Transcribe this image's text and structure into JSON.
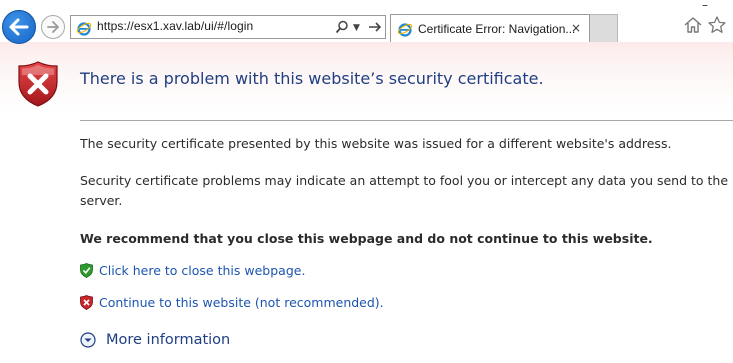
{
  "browser": {
    "address_url": "https://esx1.xav.lab/ui/#/login",
    "tab_title": "Certificate Error: Navigation...",
    "tab_close": "×",
    "minimize": "–",
    "icons": [
      "back-arrow-icon",
      "forward-arrow-icon",
      "ie-logo-icon",
      "search-icon",
      "dropdown-arrow-icon",
      "go-arrow-icon",
      "home-icon",
      "favorites-star-icon"
    ]
  },
  "content": {
    "headline": "There is a problem with this website’s security certificate.",
    "paragraph1": "The security certificate presented by this website was issued for a different website's address.",
    "paragraph2": "Security certificate problems may indicate an attempt to fool you or intercept any data you send to the server.",
    "recommendation": "We recommend that you close this webpage and do not continue to this website.",
    "close_link": "Click here to close this webpage.",
    "continue_link": "Continue to this website (not recommended).",
    "more_info": "More information",
    "icons": [
      "error-shield-icon",
      "green-shield-icon",
      "red-shield-icon",
      "expand-chevron-icon"
    ]
  },
  "colors": {
    "headline": "#1f3f82",
    "link": "#1c55b0",
    "error_red": "#c8262a",
    "ok_green": "#2e9a2e",
    "back_button": "#1e74d6"
  }
}
